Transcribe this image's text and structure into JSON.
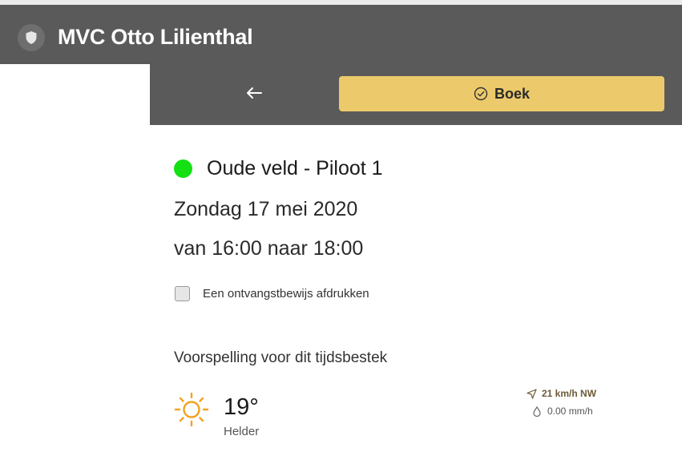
{
  "app": {
    "title": "MVC Otto Lilienthal",
    "logo_icon": "shield-icon"
  },
  "toolbar": {
    "back_icon": "arrow-left-icon",
    "book_label": "Boek",
    "book_icon": "check-circle-icon",
    "book_color": "#ecca6b"
  },
  "booking": {
    "field_name": "Oude veld - Piloot 1",
    "status_color": "#14e014",
    "date": "Zondag 17 mei 2020",
    "time_range": "van 16:00 naar 18:00",
    "receipt_label": "Een ontvangstbewijs afdrukken",
    "receipt_checked": false
  },
  "forecast": {
    "heading": "Voorspelling voor dit tijdsbestek",
    "icon": "sun-icon",
    "temperature": "19°",
    "condition": "Helder",
    "wind": "21 km/h NW",
    "wind_icon": "navigation-icon",
    "rain": "0.00 mm/h",
    "rain_icon": "droplet-icon"
  }
}
